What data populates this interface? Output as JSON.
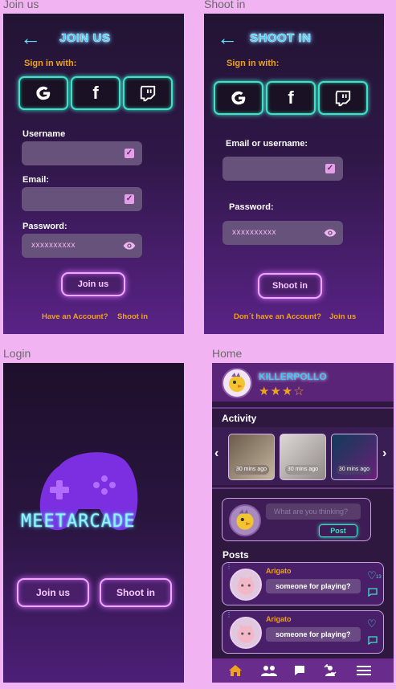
{
  "join": {
    "frame_label": "Join us",
    "title": "JOIN US",
    "sign_in_with": "Sign in with:",
    "username_label": "Username",
    "email_label": "Email:",
    "password_label": "Password:",
    "password_value": "xxxxxxxxxx",
    "button": "Join us",
    "have_account": "Have an Account?",
    "shoot_link": "Shoot in"
  },
  "shoot": {
    "frame_label": "Shoot in",
    "title": "SHOOT IN",
    "sign_in_with": "Sign in with:",
    "email_label": "Email or username:",
    "password_label": "Password:",
    "password_value": "xxxxxxxxxx",
    "button": "Shoot in",
    "no_account": "Don´t have an Account?",
    "join_link": "Join us"
  },
  "login": {
    "frame_label": "Login",
    "logo_text": "MEETARCADE",
    "join_button": "Join us",
    "shoot_button": "Shoot in"
  },
  "home": {
    "frame_label": "Home",
    "username": "KILLERPOLLO",
    "rating": 3.5,
    "activity_title": "Activity",
    "activity": [
      {
        "time": "30 mins ago"
      },
      {
        "time": "30 mins ago"
      },
      {
        "time": "30 mins ago"
      }
    ],
    "composer_placeholder": "What are you thinking?",
    "post_button": "Post",
    "posts_title": "Posts",
    "posts": [
      {
        "author": "Arigato",
        "text": "someone for playing?",
        "likes": "13"
      },
      {
        "author": "Arigato",
        "text": "someone for playing?",
        "likes": ""
      }
    ],
    "nav": [
      "home-icon",
      "friends-icon",
      "chat-icon",
      "swap-icon",
      "menu-icon"
    ]
  },
  "colors": {
    "accent_orange": "#f0a21c",
    "neon_teal": "#3fe1c8",
    "neon_pink": "#f0a8ff",
    "neon_blue": "#3cc8ff"
  }
}
